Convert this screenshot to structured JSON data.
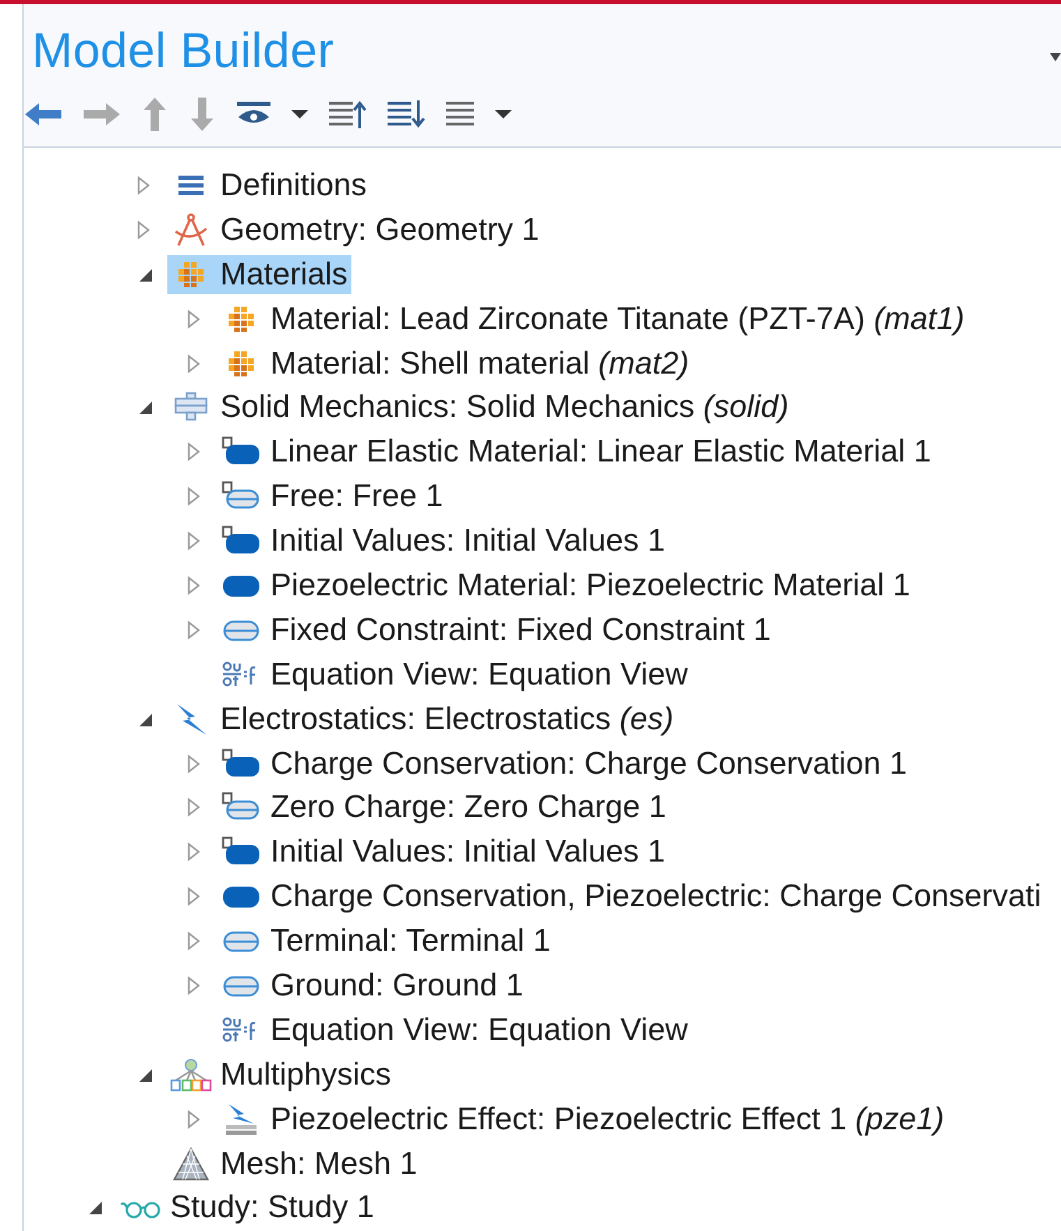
{
  "panel": {
    "title": "Model Builder"
  },
  "tree": [
    {
      "children": [
        {
          "label": "Definitions",
          "kind": "definitions",
          "expandable": true,
          "expanded": false,
          "selected": false
        },
        {
          "label": "Geometry: Geometry 1",
          "kind": "geometry",
          "expandable": true,
          "expanded": false,
          "selected": false
        },
        {
          "label": "Materials",
          "kind": "material",
          "expandable": true,
          "expanded": true,
          "selected": true,
          "children": [
            {
              "label": "Material: Lead Zirconate Titanate (PZT-7A) *(mat1)*",
              "kind": "material",
              "expandable": true,
              "expanded": false,
              "selected": false
            },
            {
              "label": "Material: Shell material *(mat2)*",
              "kind": "material",
              "expandable": true,
              "expanded": false,
              "selected": false
            }
          ]
        },
        {
          "label": "Solid Mechanics: Solid Mechanics *(solid)*",
          "kind": "solid",
          "expandable": true,
          "expanded": true,
          "selected": false,
          "children": [
            {
              "label": "Linear Elastic Material: Linear Elastic Material 1",
              "kind": "domain-default",
              "expandable": true,
              "expanded": false,
              "selected": false
            },
            {
              "label": "Free: Free 1",
              "kind": "boundary-default",
              "expandable": true,
              "expanded": false,
              "selected": false
            },
            {
              "label": "Initial Values: Initial Values 1",
              "kind": "domain-default",
              "expandable": true,
              "expanded": false,
              "selected": false
            },
            {
              "label": "Piezoelectric Material: Piezoelectric Material 1",
              "kind": "domain",
              "expandable": true,
              "expanded": false,
              "selected": false
            },
            {
              "label": "Fixed Constraint: Fixed Constraint 1",
              "kind": "boundary",
              "expandable": true,
              "expanded": false,
              "selected": false
            },
            {
              "label": "Equation View: Equation View",
              "kind": "equation",
              "expandable": false,
              "selected": false
            }
          ]
        },
        {
          "label": "Electrostatics: Electrostatics *(es)*",
          "kind": "electrostatics",
          "expandable": true,
          "expanded": true,
          "selected": false,
          "children": [
            {
              "label": "Charge Conservation: Charge Conservation 1",
              "kind": "domain-default",
              "expandable": true,
              "expanded": false,
              "selected": false
            },
            {
              "label": "Zero Charge: Zero Charge 1",
              "kind": "boundary-default",
              "expandable": true,
              "expanded": false,
              "selected": false
            },
            {
              "label": "Initial Values: Initial Values 1",
              "kind": "domain-default",
              "expandable": true,
              "expanded": false,
              "selected": false
            },
            {
              "label": "Charge Conservation, Piezoelectric: Charge Conservati",
              "kind": "domain",
              "expandable": true,
              "expanded": false,
              "selected": false
            },
            {
              "label": "Terminal: Terminal 1",
              "kind": "boundary",
              "expandable": true,
              "expanded": false,
              "selected": false
            },
            {
              "label": "Ground: Ground 1",
              "kind": "boundary",
              "expandable": true,
              "expanded": false,
              "selected": false
            },
            {
              "label": "Equation View: Equation View",
              "kind": "equation",
              "expandable": false,
              "selected": false
            }
          ]
        },
        {
          "label": "Multiphysics",
          "kind": "multiphysics",
          "expandable": true,
          "expanded": true,
          "selected": false,
          "children": [
            {
              "label": "Piezoelectric Effect: Piezoelectric Effect 1 *(pze1)*",
              "kind": "coupling",
              "expandable": true,
              "expanded": false,
              "selected": false
            }
          ]
        },
        {
          "label": "Mesh: Mesh 1",
          "kind": "mesh",
          "expandable": false,
          "selected": false
        }
      ]
    },
    {
      "label": "Study: Study 1",
      "kind": "study",
      "expandable": true,
      "expanded": true,
      "selected": false
    }
  ]
}
